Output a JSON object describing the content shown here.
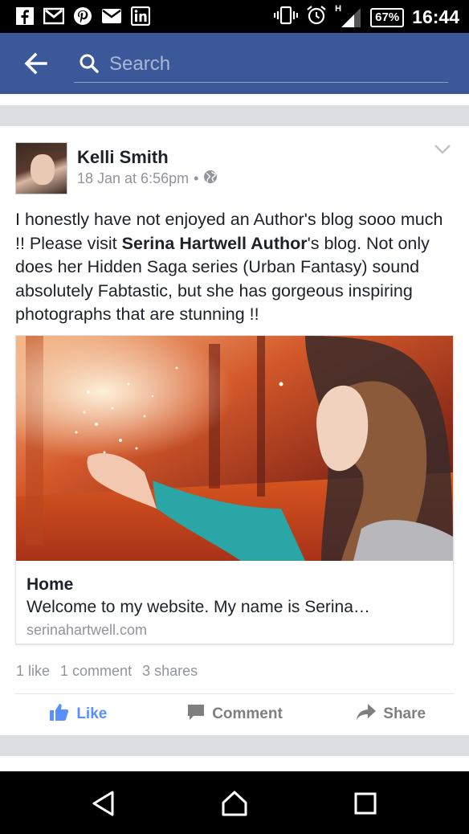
{
  "status_bar": {
    "notification_icons": [
      "facebook-icon",
      "gmail-icon",
      "pinterest-icon",
      "email-icon",
      "linkedin-icon"
    ],
    "network_label": "H",
    "battery": "67%",
    "time": "16:44"
  },
  "app_bar": {
    "search_placeholder": "Search",
    "color": "#3b5998"
  },
  "post": {
    "author": "Kelli Smith",
    "timestamp": "18 Jan at 6:56pm",
    "separator": "•",
    "privacy_icon": "globe-icon",
    "text_before": "I honestly have not enjoyed an Author's blog sooo much !! Please visit ",
    "mention": "Serina Hartwell Author",
    "text_after": "'s blog. Not only does her Hidden Saga series (Urban Fantasy) sound absolutely Fabtastic, but she has gorgeous inspiring photographs that are stunning !!",
    "link_card": {
      "title": "Home",
      "description": "Welcome to my website. My name is Serina…",
      "domain": "serinahartwell.com"
    },
    "stats": {
      "likes": "1 like",
      "comments": "1 comment",
      "shares": "3 shares"
    },
    "actions": {
      "like": "Like",
      "comment": "Comment",
      "share": "Share"
    },
    "like_color": "#5890ff"
  }
}
